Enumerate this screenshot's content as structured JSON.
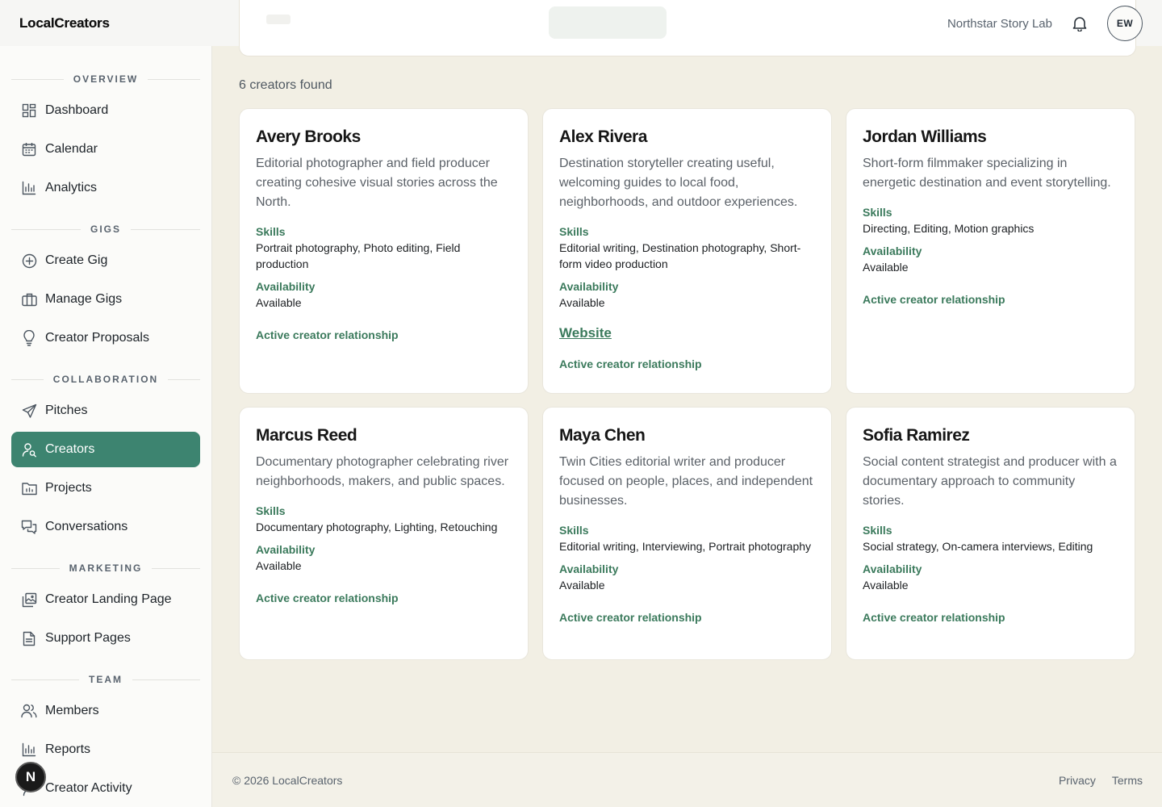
{
  "app": {
    "brand": "LocalCreators"
  },
  "header": {
    "org_name": "Northstar Story Lab",
    "avatar_initials": "EW"
  },
  "sidebar": {
    "sections": [
      {
        "title": "OVERVIEW"
      },
      {
        "title": "GIGS"
      },
      {
        "title": "COLLABORATION"
      },
      {
        "title": "MARKETING"
      },
      {
        "title": "TEAM"
      }
    ],
    "items": [
      {
        "label": "Dashboard",
        "icon": "grid-icon"
      },
      {
        "label": "Calendar",
        "icon": "calendar-icon"
      },
      {
        "label": "Analytics",
        "icon": "bar-chart-icon"
      },
      {
        "label": "Create Gig",
        "icon": "plus-circle-icon"
      },
      {
        "label": "Manage Gigs",
        "icon": "briefcase-icon"
      },
      {
        "label": "Creator Proposals",
        "icon": "lightbulb-icon"
      },
      {
        "label": "Pitches",
        "icon": "send-icon"
      },
      {
        "label": "Creators",
        "icon": "user-search-icon",
        "active": true
      },
      {
        "label": "Projects",
        "icon": "folder-icon"
      },
      {
        "label": "Conversations",
        "icon": "chat-icon"
      },
      {
        "label": "Creator Landing Page",
        "icon": "image-stack-icon"
      },
      {
        "label": "Support Pages",
        "icon": "document-icon"
      },
      {
        "label": "Members",
        "icon": "users-icon"
      },
      {
        "label": "Reports",
        "icon": "bar-chart-icon"
      },
      {
        "label": "Creator Activity",
        "icon": "activity-icon"
      }
    ],
    "floating_badge": "N"
  },
  "main": {
    "results_count": "6 creators found",
    "labels": {
      "skills": "Skills",
      "availability": "Availability",
      "relationship": "Active creator relationship",
      "website": "Website"
    },
    "creators": [
      {
        "name": "Avery Brooks",
        "bio": "Editorial photographer and field producer creating cohesive visual stories across the North.",
        "skills": "Portrait photography, Photo editing, Field production",
        "availability": "Available"
      },
      {
        "name": "Alex Rivera",
        "bio": "Destination storyteller creating useful, welcoming guides to local food, neighborhoods, and outdoor experiences.",
        "skills": "Editorial writing, Destination photography, Short-form video production",
        "availability": "Available",
        "has_website": true
      },
      {
        "name": "Jordan Williams",
        "bio": "Short-form filmmaker specializing in energetic destination and event storytelling.",
        "skills": "Directing, Editing, Motion graphics",
        "availability": "Available"
      },
      {
        "name": "Marcus Reed",
        "bio": "Documentary photographer celebrating river neighborhoods, makers, and public spaces.",
        "skills": "Documentary photography, Lighting, Retouching",
        "availability": "Available"
      },
      {
        "name": "Maya Chen",
        "bio": "Twin Cities editorial writer and producer focused on people, places, and independent businesses.",
        "skills": "Editorial writing, Interviewing, Portrait photography",
        "availability": "Available"
      },
      {
        "name": "Sofia Ramirez",
        "bio": "Social content strategist and producer with a documentary approach to community stories.",
        "skills": "Social strategy, On-camera interviews, Editing",
        "availability": "Available"
      }
    ]
  },
  "footer": {
    "copyright": "© 2026 LocalCreators",
    "links": [
      "Privacy",
      "Terms"
    ]
  },
  "colors": {
    "accent": "#3d8470",
    "label_green": "#3b7a5c",
    "page_bg": "#f2efe4"
  }
}
